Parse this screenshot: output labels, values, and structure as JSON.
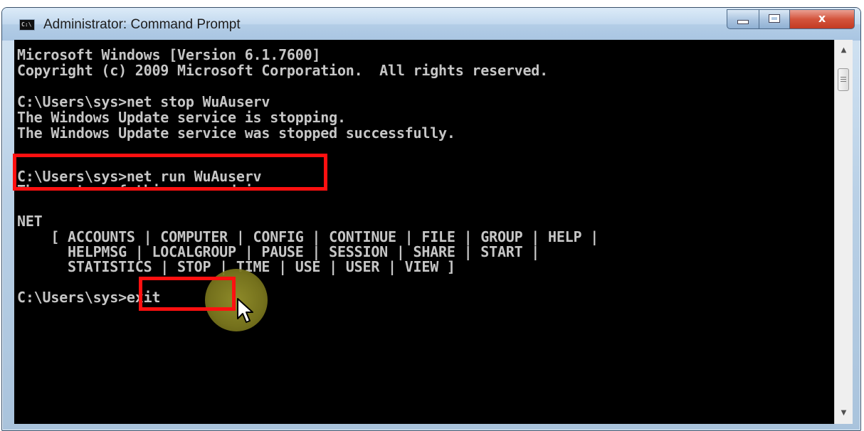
{
  "window": {
    "title": "Administrator: Command Prompt",
    "icon_label": "C:\\"
  },
  "controls": {
    "minimize": "minimize",
    "maximize": "maximize",
    "close": "x"
  },
  "console": {
    "lines": [
      "Microsoft Windows [Version 6.1.7600]",
      "Copyright (c) 2009 Microsoft Corporation.  All rights reserved.",
      "",
      "C:\\Users\\sys>net stop WuAuserv",
      "The Windows Update service is stopping.",
      "The Windows Update service was stopped successfully.",
      "",
      "",
      "C:\\Users\\sys>net run WuAuserv",
      "The syntax of this command is:",
      "",
      "NET",
      "    [ ACCOUNTS | COMPUTER | CONFIG | CONTINUE | FILE | GROUP | HELP |",
      "      HELPMSG | LOCALGROUP | PAUSE | SESSION | SHARE | START |",
      "      STATISTICS | STOP | TIME | USE | USER | VIEW ]",
      "",
      "C:\\Users\\sys>exit"
    ]
  },
  "colors": {
    "console_bg": "#000000",
    "console_text": "#c6c6c6",
    "highlight": "#ff1010",
    "close_button": "#c23a22"
  },
  "icons": [
    "cmd-app-icon",
    "minimize-icon",
    "maximize-icon",
    "close-icon",
    "scroll-up-arrow-icon",
    "scroll-down-arrow-icon",
    "mouse-pointer-icon"
  ]
}
